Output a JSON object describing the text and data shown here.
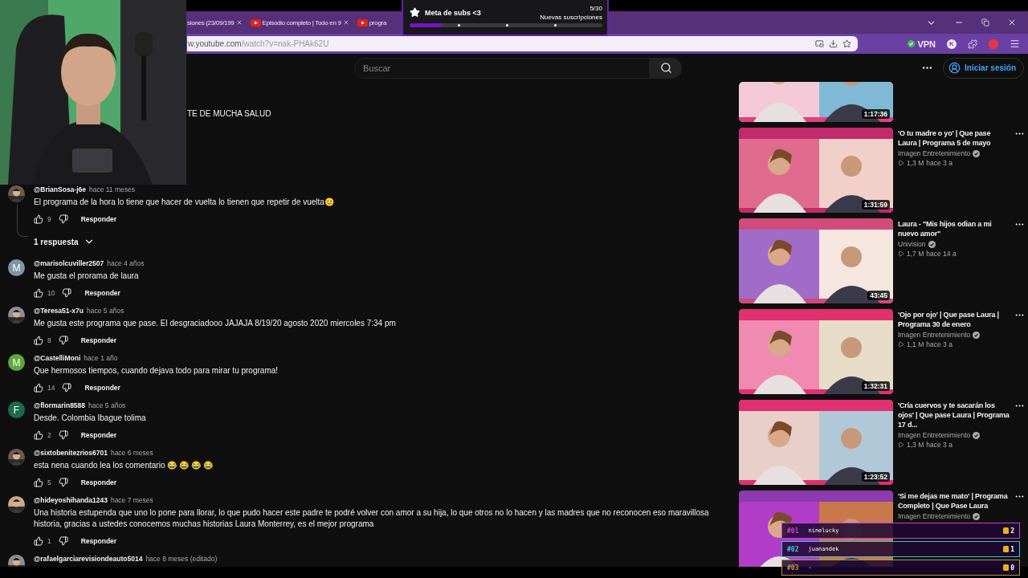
{
  "browser": {
    "tabs": [
      {
        "title": "siones (23/09/199",
        "favicon": false,
        "closable": true
      },
      {
        "title": "Episodio completo | Todo en 9",
        "favicon": true,
        "closable": true
      },
      {
        "title": "progra",
        "favicon": true,
        "closable": false
      }
    ],
    "address": {
      "host": "w.youtube.com",
      "path": "/watch?v=nak-PHAk62U"
    },
    "vpn": {
      "label": "VPN",
      "on": true
    },
    "profile_initial": "K"
  },
  "youtube": {
    "search": {
      "placeholder": "Buscar"
    },
    "sign_in": "Iniciar sesión",
    "description_fragment": "TE DE MUCHA SALUD",
    "comments": [
      {
        "author": "@BrianSosa-j6e",
        "time": "hace 11 meses",
        "text": "El programa de la hora lo tiene que hacer de vuelta lo tienen que repetir de vuelta😊",
        "likes": "9",
        "reply": "Responder",
        "replies": {
          "label": "1 respuesta",
          "expanded": false
        }
      },
      {
        "author": "@marisolcuviller2507",
        "time": "hace 4 años",
        "text": "Me gusta el prorama de laura",
        "likes": "10",
        "reply": "Responder",
        "avatar": {
          "kind": "letter",
          "letter": "M",
          "color": "#7d98a4"
        }
      },
      {
        "author": "@Teresa51-x7u",
        "time": "hace 5 años",
        "text": "Me gusta este programa que pase. El desgraciadooo JAJAJA 8/19/20 agosto 2020 miercoles 7:34 pm",
        "likes": "8",
        "reply": "Responder"
      },
      {
        "author": "@CastelliMoni",
        "time": "hace 1 año",
        "text": "Que hermosos tiempos, cuando dejava todo para mirar tu programa!",
        "likes": "14",
        "reply": "Responder",
        "avatar": {
          "kind": "letter",
          "letter": "M",
          "color": "#5ca83c"
        }
      },
      {
        "author": "@flormarin8588",
        "time": "hace 5 años",
        "text": "Desde. Colombia Ibague tolima",
        "likes": "2",
        "reply": "Responder",
        "avatar": {
          "kind": "letter",
          "letter": "F",
          "color": "#1d6a4c"
        }
      },
      {
        "author": "@sixtobenitezrios6701",
        "time": "hace 6 meses",
        "text": "esta nena cuando lea los comentario 😂 😂 😂 😂",
        "likes": "5",
        "reply": "Responder"
      },
      {
        "author": "@hideyoshihanda1243",
        "time": "hace 7 meses",
        "text": "Una historia estupenda que uno lo pone para llorar, lo que pudo hacer este padre te podré volver con amor a su hija, lo que otros no lo hacen y las madres que no reconocen eso maravillosa historia, gracias a ustedes conocemos muchas historias Laura Monterrey, es el mejor programa",
        "likes": "1",
        "reply": "Responder"
      },
      {
        "author": "@rafaelgarciarevisiondeauto5014",
        "time": "hace 8 meses (editado)"
      }
    ],
    "videos": [
      {
        "kind": "partial",
        "duration": "1:17:36"
      },
      {
        "kind": "full",
        "title": "'O tu madre o yo' | Que pase Laura | Programa 5 de mayo",
        "channel": "Imagen Entretenimiento",
        "verified": true,
        "views": "1,3 M",
        "age": "hace 3 a",
        "duration": "1:31:59"
      },
      {
        "kind": "full",
        "title": "Laura - \"Mis hijos odian a mi nuevo amor\"",
        "channel": "Univision",
        "verified": true,
        "views": "1,7 M",
        "age": "hace 14 a",
        "duration": "43:45"
      },
      {
        "kind": "full",
        "title": "'Ojo por ojo' | Que pase Laura | Programa 30 de enero",
        "channel": "Imagen Entretenimiento",
        "verified": true,
        "views": "1,1 M",
        "age": "hace 3 a",
        "duration": "1:32:31"
      },
      {
        "kind": "full",
        "title": "'Cría cuervos y te sacarán los ojos' | Que pase Laura | Programa 17 d...",
        "channel": "Imagen Entretenimiento",
        "verified": true,
        "views": "1,3 M",
        "age": "hace 3 a",
        "duration": "1:23:52"
      },
      {
        "kind": "full",
        "title": "'Si me dejas me mato' | Programa Completo | Que Pase Laura",
        "channel": "Imagen Entretenimiento",
        "verified": true
      }
    ]
  },
  "goal": {
    "title": "Meta de subs <3",
    "count": "5/30",
    "subtitle": "Nuevas suscripciones",
    "level": 0.17
  },
  "leaderboard": [
    {
      "rank": "#01",
      "name": "ninelucky",
      "count": "2",
      "color": "#d23fcf"
    },
    {
      "rank": "#02",
      "name": "juanandek",
      "count": "1",
      "color": "#36c3dc"
    },
    {
      "rank": "#03",
      "name": "-",
      "count": "0",
      "color": "#b8963a"
    }
  ]
}
